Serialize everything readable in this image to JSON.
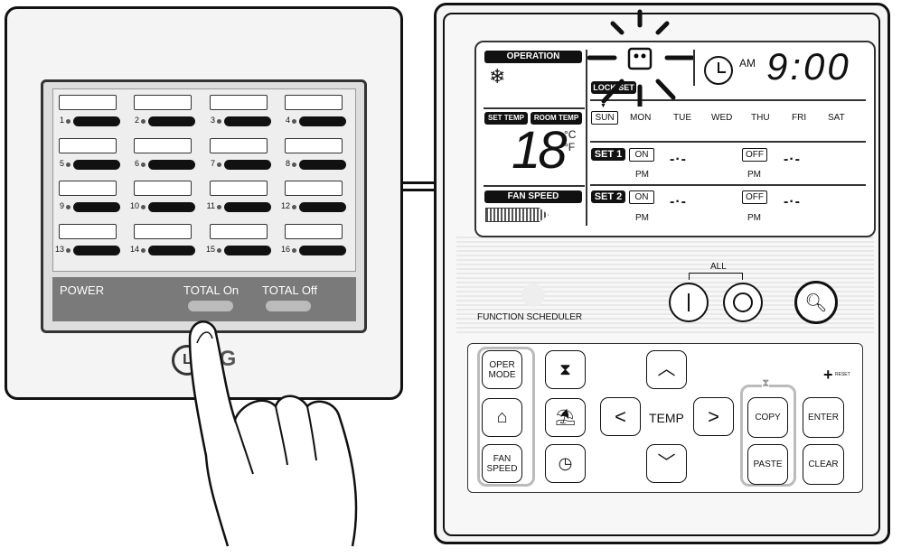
{
  "central_controller": {
    "units": [
      "1",
      "2",
      "3",
      "4",
      "5",
      "6",
      "7",
      "8",
      "9",
      "10",
      "11",
      "12",
      "13",
      "14",
      "15",
      "16"
    ],
    "power_label": "POWER",
    "total_on_label": "TOTAL On",
    "total_off_label": "TOTAL Off",
    "logo": "LG"
  },
  "scheduler": {
    "lcd": {
      "operation": "OPERATION",
      "set_temp": "SET TEMP",
      "room_temp": "ROOM TEMP",
      "temperature": "18",
      "unit_c": "°C",
      "unit_f": "°F",
      "fan_speed": "FAN SPEED",
      "lock_label": "LOCK SET",
      "am": "AM",
      "time": "9:00",
      "days": [
        "SUN",
        "MON",
        "TUE",
        "WED",
        "THU",
        "FRI",
        "SAT"
      ],
      "set1": "SET 1",
      "set2": "SET 2",
      "on": "ON",
      "off": "OFF",
      "pm": "PM",
      "blank_time": "-·-"
    },
    "all_label": "ALL",
    "function_label": "FUNCTION SCHEDULER",
    "buttons": {
      "oper_mode": "OPER MODE",
      "fan_speed": "FAN SPEED",
      "temp": "TEMP",
      "copy": "COPY",
      "paste": "PASTE",
      "enter": "ENTER",
      "clear": "CLEAR",
      "reset": "RESET"
    }
  }
}
